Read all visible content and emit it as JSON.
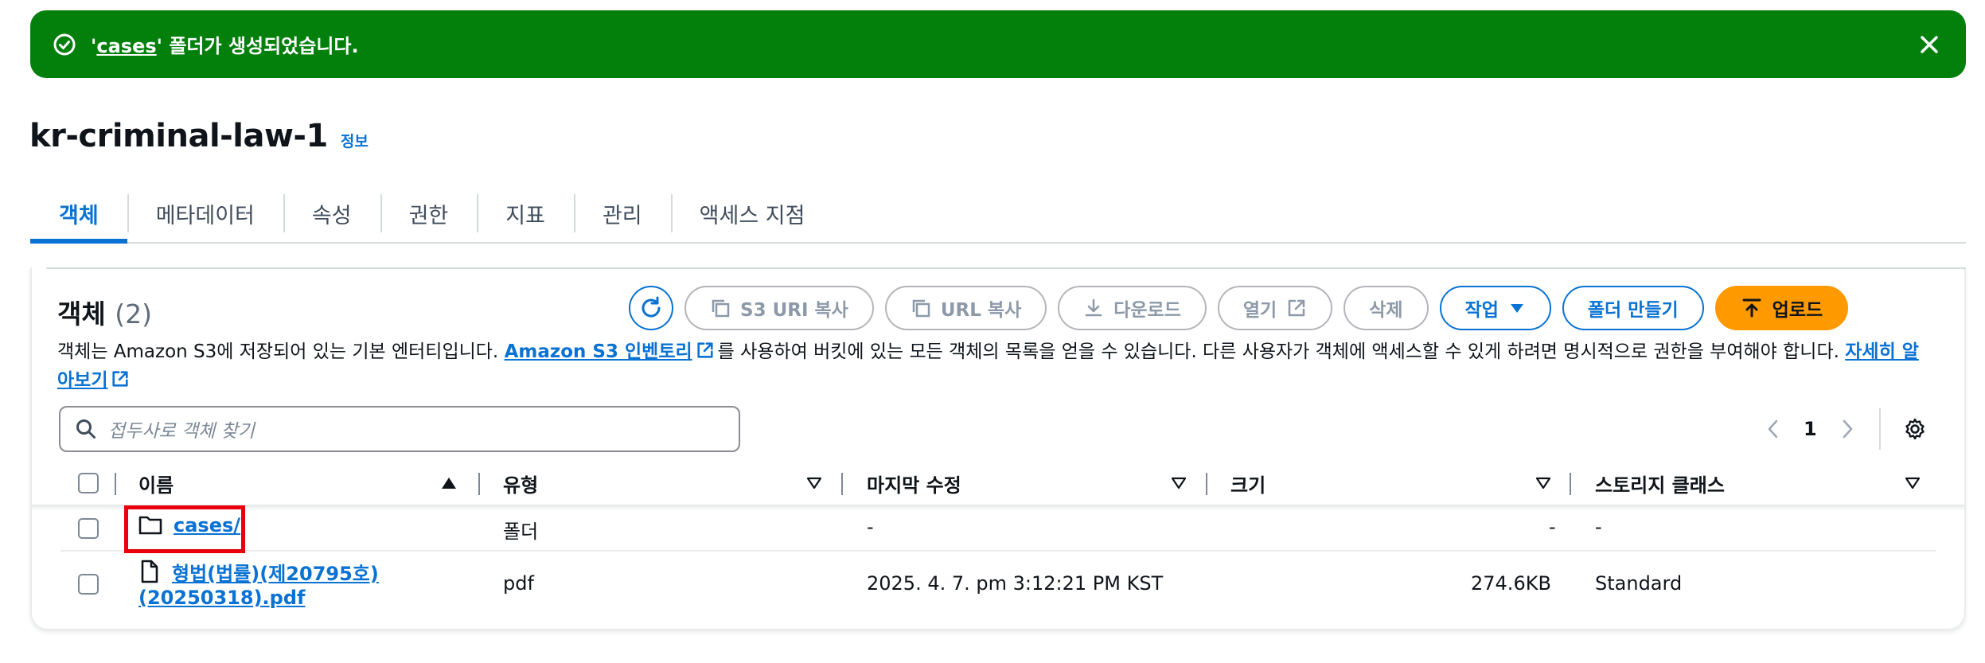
{
  "flash": {
    "folder_name": "cases",
    "message_pre": "'",
    "message_post": "' 폴더가 생성되었습니다."
  },
  "bucket": {
    "name": "kr-criminal-law-1",
    "info_link": "정보"
  },
  "tabs": [
    "객체",
    "메타데이터",
    "속성",
    "권한",
    "지표",
    "관리",
    "액세스 지점"
  ],
  "objects": {
    "title": "객체",
    "count": "(2)",
    "actions": {
      "copy_s3_uri": "S3 URI 복사",
      "copy_url": "URL 복사",
      "download": "다운로드",
      "open": "열기",
      "delete": "삭제",
      "actions_menu": "작업",
      "create_folder": "폴더 만들기",
      "upload": "업로드"
    },
    "description": {
      "part1": "객체는 Amazon S3에 저장되어 있는 기본 엔터티입니다. ",
      "inventory_link": "Amazon S3 인벤토리",
      "part2": "를 사용하여 버킷에 있는 모든 객체의 목록을 얻을 수 있습니다. 다른 사용자가 객체에 액세스할 수 있게 하려면 명시적으로 권한을 부여해야 합니다. ",
      "learn_more_link": "자세히 알아보기"
    },
    "search_placeholder": "접두사로 객체 찾기",
    "page": "1"
  },
  "table": {
    "columns": [
      "이름",
      "유형",
      "마지막 수정",
      "크기",
      "스토리지 클래스"
    ],
    "rows": [
      {
        "name": "cases/",
        "type": "폴더",
        "modified": "-",
        "size": "-",
        "storage": "-"
      },
      {
        "name_line1": "형법(법률)(제20795호)",
        "name_line2": "(20250318).pdf",
        "type": "pdf",
        "modified": "2025. 4. 7. pm 3:12:21 PM KST",
        "size": "274.6KB",
        "storage": "Standard"
      }
    ]
  },
  "colors": {
    "success": "#037f0c",
    "link": "#0972d3",
    "primary": "#ff9900",
    "highlight": "#e8000b"
  }
}
